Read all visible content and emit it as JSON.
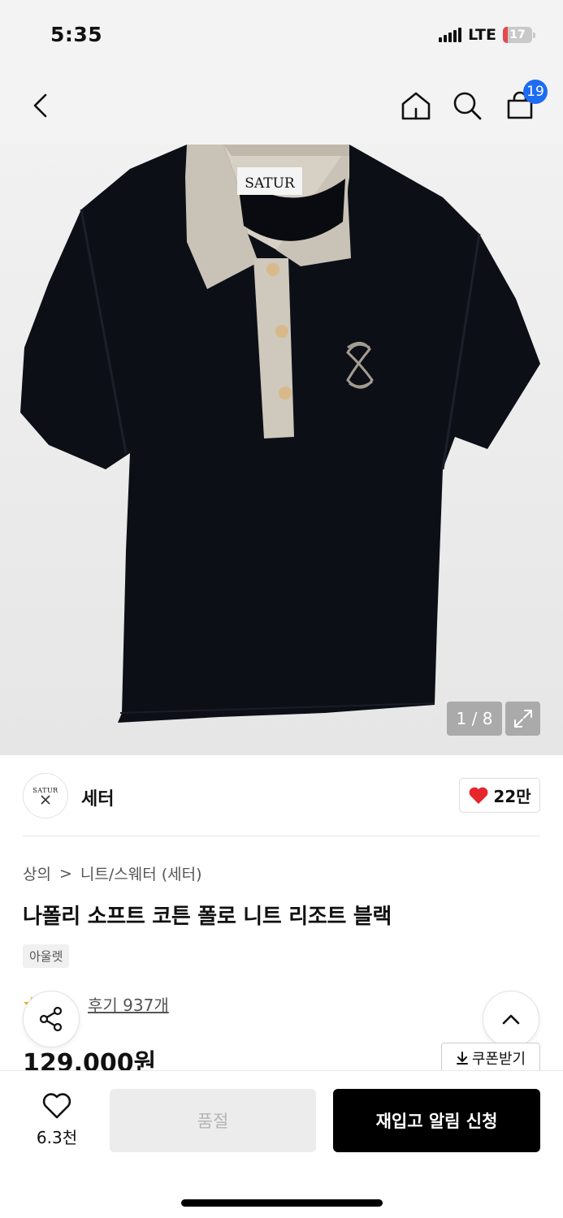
{
  "status_bar": {
    "time": "5:35",
    "network": "LTE",
    "battery": "17",
    "battery_level": 0.17
  },
  "nav": {
    "cart_count": "19",
    "icons": [
      "back-icon",
      "home-icon",
      "search-icon",
      "cart-icon"
    ]
  },
  "product_image": {
    "logo_label": "SATUR",
    "counter": "1 / 8"
  },
  "brand": {
    "logo_text": "SATUR",
    "name": "세터",
    "likes": "22만"
  },
  "breadcrumb": {
    "category": "상의",
    "separator": ">",
    "subcategory": "니트/스웨터 (세터)"
  },
  "product": {
    "title": "나폴리 소프트 코튼 폴로 니트 리조트 블랙",
    "tag": "아울렛",
    "review_text": "후기 937개",
    "price": "129,000원"
  },
  "actions": {
    "coupon_label": "쿠폰받기",
    "wish_count": "6.3천",
    "soldout_label": "품절",
    "restock_label": "재입고 알림 신청"
  },
  "colors": {
    "accent_blue": "#1e6cf2",
    "heart_red": "#e5262b",
    "battery_red": "#e5484d",
    "star": "#f5a623"
  }
}
